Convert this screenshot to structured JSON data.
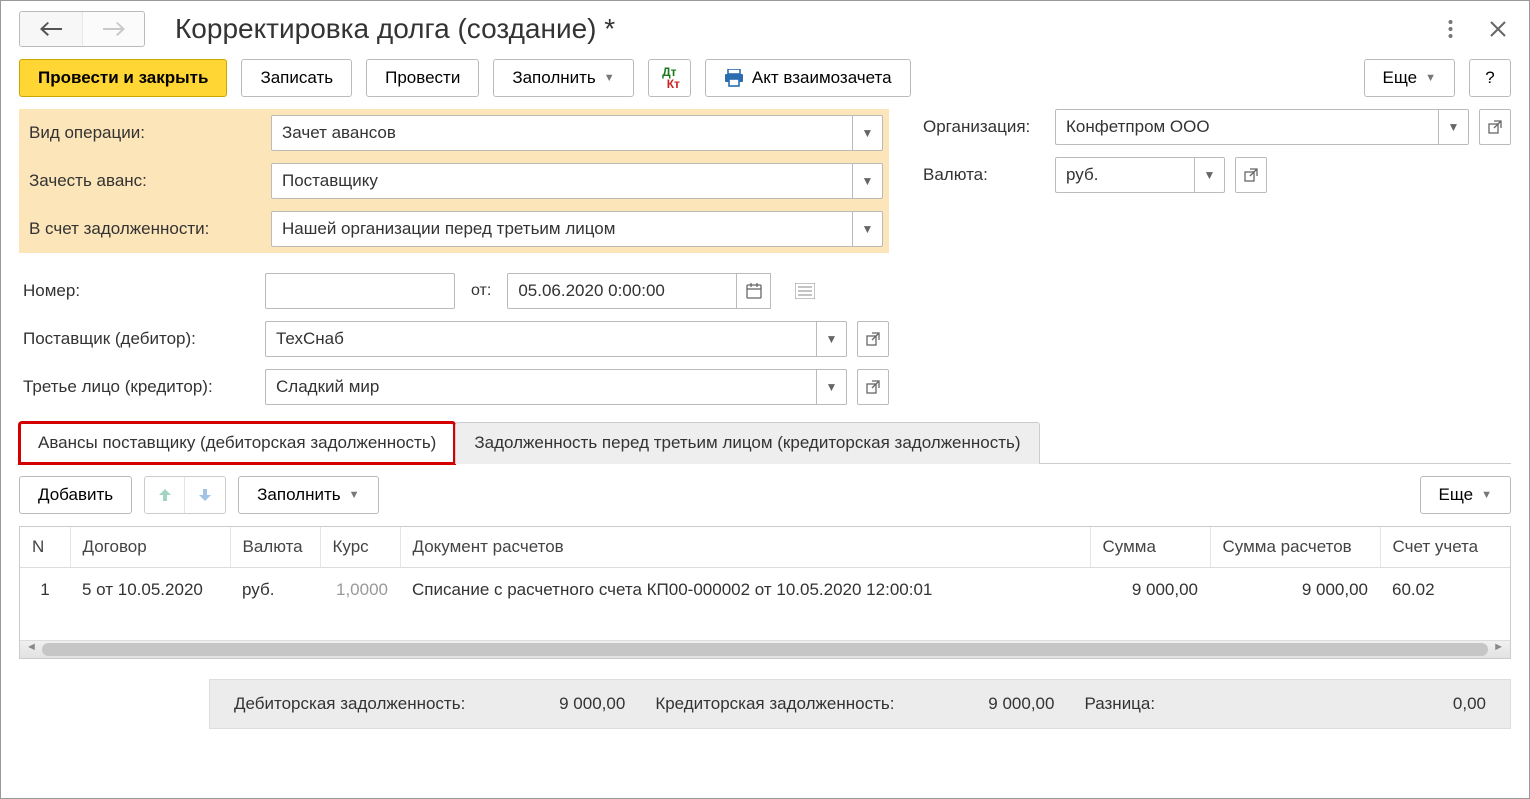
{
  "title": "Корректировка долга (создание) *",
  "toolbar": {
    "post_close": "Провести и закрыть",
    "save": "Записать",
    "post": "Провести",
    "fill": "Заполнить",
    "offset_act": "Акт взаимозачета",
    "more": "Еще",
    "help": "?"
  },
  "fields": {
    "operation_kind_label": "Вид операции:",
    "operation_kind_value": "Зачет авансов",
    "offset_advance_label": "Зачесть аванс:",
    "offset_advance_value": "Поставщику",
    "against_debt_label": "В счет задолженности:",
    "against_debt_value": "Нашей организации перед третьим лицом",
    "number_label": "Номер:",
    "number_value": "",
    "date_label": "от:",
    "date_value": "05.06.2020  0:00:00",
    "supplier_label": "Поставщик (дебитор):",
    "supplier_value": "ТехСнаб",
    "third_party_label": "Третье лицо (кредитор):",
    "third_party_value": "Сладкий мир",
    "org_label": "Организация:",
    "org_value": "Конфетпром ООО",
    "currency_label": "Валюта:",
    "currency_value": "руб."
  },
  "tabs": {
    "tab1": "Авансы поставщику (дебиторская задолженность)",
    "tab2": "Задолженность перед третьим лицом (кредиторская задолженность)"
  },
  "grid": {
    "add": "Добавить",
    "fill": "Заполнить",
    "more": "Еще",
    "cols": {
      "n": "N",
      "contract": "Договор",
      "currency": "Валюта",
      "rate": "Курс",
      "doc": "Документ расчетов",
      "sum": "Сумма",
      "sum_calc": "Сумма расчетов",
      "account": "Счет учета"
    },
    "rows": [
      {
        "n": "1",
        "contract": "5 от 10.05.2020",
        "currency": "руб.",
        "rate": "1,0000",
        "doc": "Списание с расчетного счета КП00-000002 от 10.05.2020 12:00:01",
        "sum": "9 000,00",
        "sum_calc": "9 000,00",
        "account": "60.02"
      }
    ]
  },
  "footer": {
    "debit_label": "Дебиторская задолженность:",
    "debit_value": "9 000,00",
    "credit_label": "Кредиторская задолженность:",
    "credit_value": "9 000,00",
    "diff_label": "Разница:",
    "diff_value": "0,00"
  }
}
